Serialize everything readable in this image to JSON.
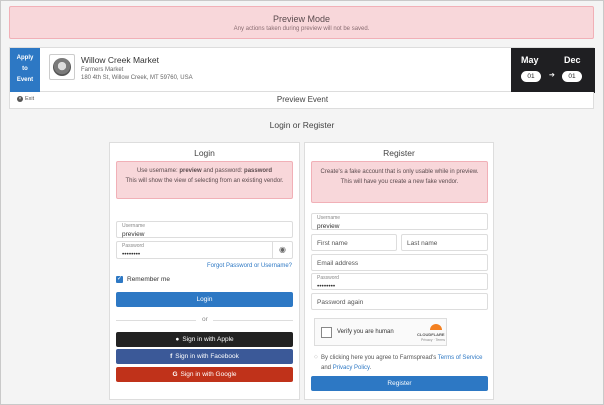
{
  "banner": {
    "title": "Preview Mode",
    "subtitle": "Any actions taken during preview will not be saved."
  },
  "event": {
    "apply_label": [
      "Apply",
      "to",
      "Event"
    ],
    "market_name": "Willow Creek Market",
    "market_type": "Farmers Market",
    "address": "180 4th St, Willow Creek, MT 59760, USA",
    "start_month": "May",
    "start_day": "01",
    "end_month": "Dec",
    "end_day": "01"
  },
  "preview_bar": {
    "exit_label": "Exit",
    "title": "Preview Event"
  },
  "page_heading": "Login or Register",
  "login": {
    "title": "Login",
    "note_line1_prefix": "Use username: ",
    "note_username": "preview",
    "note_line1_mid": " and password: ",
    "note_password": "password",
    "note_line2": "This will show the view of selecting from an existing vendor.",
    "username_label": "Username",
    "username_value": "preview",
    "password_label": "Password",
    "password_value": "••••••••",
    "forgot_link": "Forgot Password or Username?",
    "remember_label": "Remember me",
    "remember_checked": true,
    "login_button": "Login",
    "or_label": "or",
    "apple_button": "Sign in with Apple",
    "facebook_button": "Sign in with Facebook",
    "google_button": "Sign in with Google",
    "colors": {
      "apple": "#222222",
      "facebook": "#3b5998",
      "google": "#c0321a"
    }
  },
  "register": {
    "title": "Register",
    "note_line1": "Create's a fake account that is only usable while in preview.",
    "note_line2": "This will have you create a new fake vendor.",
    "username_label": "Username",
    "username_value": "preview",
    "first_name_placeholder": "First name",
    "last_name_placeholder": "Last name",
    "email_placeholder": "Email address",
    "password_label": "Password",
    "password_value": "••••••••",
    "password_again_placeholder": "Password again",
    "captcha_label": "Verify you are human",
    "captcha_brand": "CLOUDFLARE",
    "captcha_links": "Privacy · Terms",
    "terms_prefix": "By clicking here you agree to Farmspread's ",
    "terms_link": "Terms of Service",
    "terms_and": " and ",
    "privacy_link": "Privacy Policy",
    "terms_suffix": ".",
    "register_button": "Register"
  },
  "accent_color": "#2d78c4"
}
